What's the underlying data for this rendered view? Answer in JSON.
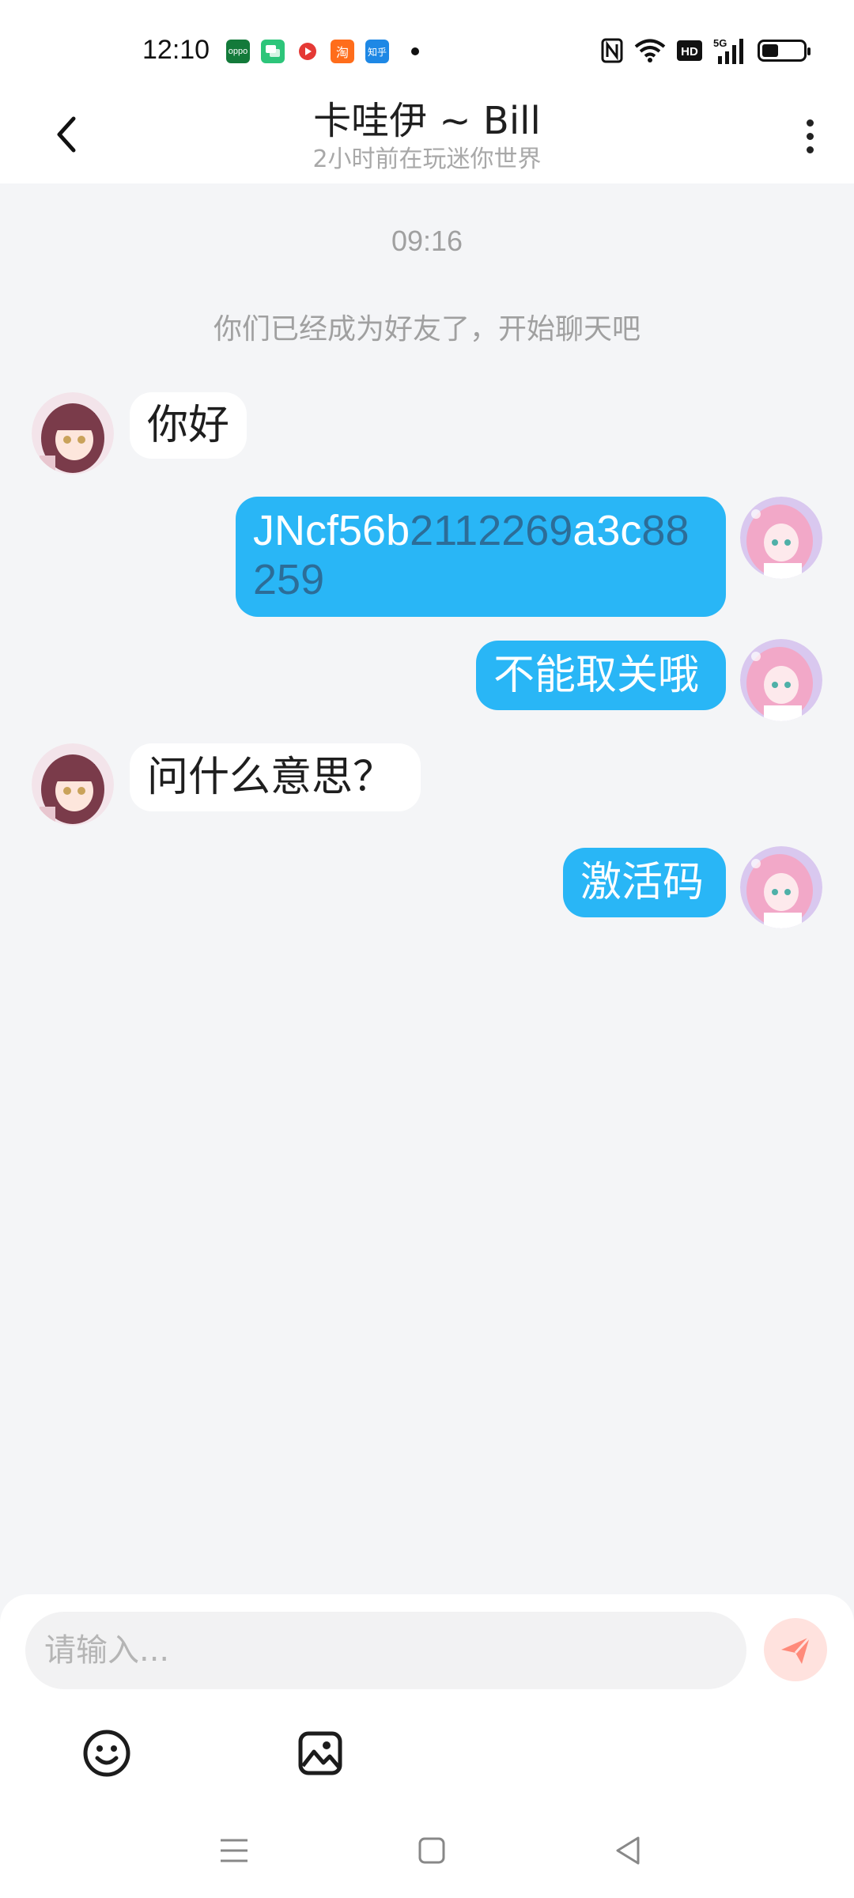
{
  "status_bar": {
    "time": "12:10",
    "notification_icons": [
      {
        "name": "oppo-app-icon",
        "label": "oppo",
        "color": "#137a3a"
      },
      {
        "name": "messages-app-icon",
        "label": "",
        "color": "#2dc57a"
      },
      {
        "name": "video-app-icon",
        "label": "",
        "color": "#e53935"
      },
      {
        "name": "taobao-app-icon",
        "label": "淘",
        "color": "#ff6d1b"
      },
      {
        "name": "zhihu-app-icon",
        "label": "知乎",
        "color": "#1e88e5"
      }
    ],
    "system_icons": [
      "nfc-icon",
      "wifi-icon",
      "hd-icon",
      "5g-signal-icon",
      "battery-icon"
    ],
    "battery_level": 0.4,
    "signal_label": "5G",
    "hd_label": "HD"
  },
  "header": {
    "title": "卡哇伊 ~ Bill",
    "subtitle": "2小时前在玩迷你世界"
  },
  "chat": {
    "timestamp": "09:16",
    "system_message": "你们已经成为好友了，开始聊天吧",
    "messages": [
      {
        "direction": "incoming",
        "text": "你好"
      },
      {
        "direction": "outgoing",
        "segments": [
          "JNcf56b",
          "2112269",
          "a3c",
          "88",
          "259"
        ]
      },
      {
        "direction": "outgoing",
        "text": "不能取关哦"
      },
      {
        "direction": "incoming",
        "text": "问什么意思？"
      },
      {
        "direction": "outgoing",
        "text": "激活码"
      }
    ]
  },
  "input": {
    "placeholder": "请输入...",
    "value": ""
  },
  "colors": {
    "outgoing_bubble": "#29b6f6",
    "incoming_bubble": "#ffffff",
    "background": "#f4f5f7",
    "send_button": "#ffe2de",
    "send_icon": "#ff8a7a"
  },
  "toolbar": [
    "emoji-icon",
    "image-icon"
  ],
  "nav_bar": [
    "menu-icon",
    "home-icon",
    "back-triangle-icon"
  ]
}
